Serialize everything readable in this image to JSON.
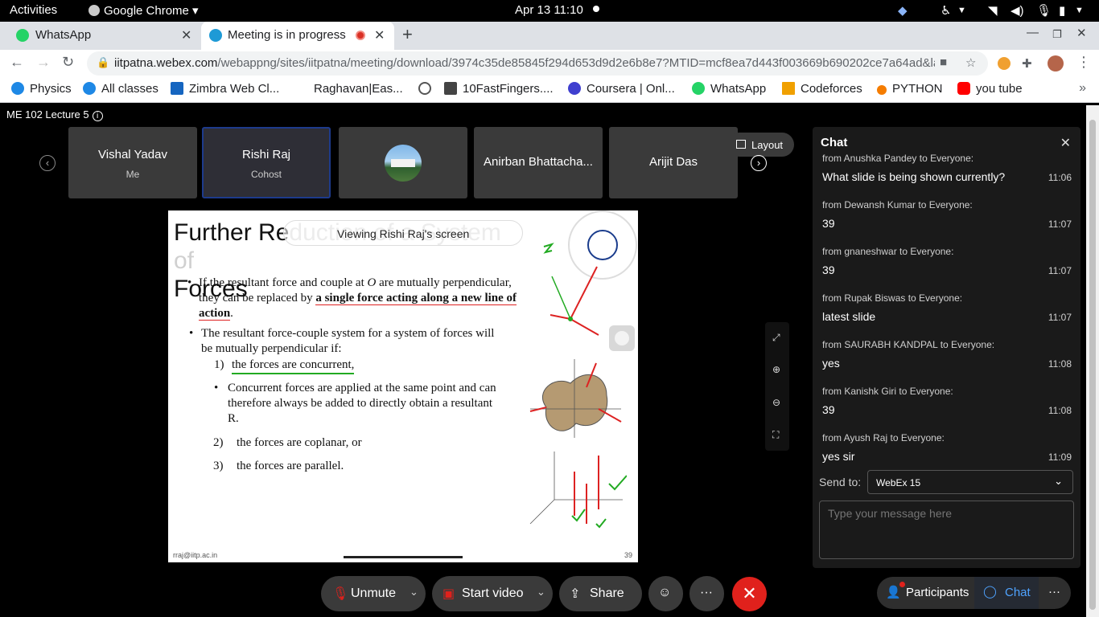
{
  "system": {
    "activities": "Activities",
    "app": "Google Chrome",
    "datetime": "Apr 13  11:10"
  },
  "tabs": [
    {
      "title": "WhatsApp"
    },
    {
      "title": "Meeting is in progress"
    }
  ],
  "toolbar": {
    "url_host": "iitpatna.webex.com",
    "url_path": "/webappng/sites/iitpatna/meeting/download/3974c35de85845f294d653d9d2e6b8e7?MTID=mcf8ea7d443f003669b690202ce7a64ad&la..."
  },
  "bookmarks": [
    {
      "label": "Physics",
      "color": "#1e88e5"
    },
    {
      "label": "All classes",
      "color": "#1e88e5"
    },
    {
      "label": "Zimbra Web Cl...",
      "color": "#1565c0"
    },
    {
      "label": "Raghavan|Eas...",
      "color": ""
    },
    {
      "label": "10FastFingers....",
      "color": "#444444"
    },
    {
      "label": "Coursera | Onl...",
      "color": "#3f3fcf"
    },
    {
      "label": "WhatsApp",
      "color": "#25d366"
    },
    {
      "label": "Codeforces",
      "color": "#f0a000"
    },
    {
      "label": "PYTHON",
      "color": "#f57c00"
    },
    {
      "label": "you tube",
      "color": "#ff0000"
    }
  ],
  "meeting": {
    "title": "ME 102 Lecture 5",
    "participants": [
      {
        "name": "Vishal Yadav",
        "role": "Me"
      },
      {
        "name": "Rishi Raj",
        "role": "Cohost"
      },
      {
        "name": "",
        "role": ""
      },
      {
        "name": "Anirban Bhattacha...",
        "role": ""
      },
      {
        "name": "Arijit Das",
        "role": ""
      }
    ],
    "layout_label": "Layout",
    "viewing_label": "Viewing Rishi Raj's screen"
  },
  "slide": {
    "title_part1": "Further Re",
    "title_faded": "duction of a System of",
    "title_line2": "Forces",
    "bullet1_a": "If the resultant force and couple at ",
    "bullet1_o": "O",
    "bullet1_b": " are mutually perpendicular, they can be replaced by ",
    "bullet1_bold": "a single force acting along a new line of action",
    "bullet1_c": ".",
    "bullet2": "The resultant force-couple system for a system of forces will be mutually perpendicular if:",
    "item1_num": "1)",
    "item1": "the forces are concurrent,",
    "sub_bullet": "Concurrent forces are applied at the same point and can therefore always be added to directly obtain a resultant R.",
    "item2_num": "2)",
    "item2": "the forces are coplanar, or",
    "item3_num": "3)",
    "item3": "the forces are parallel.",
    "footer_left": "rraj@iitp.ac.in",
    "page_number": "39"
  },
  "chat": {
    "title": "Chat",
    "messages": [
      {
        "from": "from Anushka Pandey to Everyone:",
        "text": "What slide is being shown currently?",
        "time": "11:06"
      },
      {
        "from": "from Dewansh Kumar to Everyone:",
        "text": "39",
        "time": "11:07"
      },
      {
        "from": "from gnaneshwar to Everyone:",
        "text": "39",
        "time": "11:07"
      },
      {
        "from": "from Rupak Biswas to Everyone:",
        "text": "latest slide",
        "time": "11:07"
      },
      {
        "from": "from SAURABH KANDPAL to Everyone:",
        "text": "yes",
        "time": "11:08"
      },
      {
        "from": "from Kanishk Giri to Everyone:",
        "text": "39",
        "time": "11:08"
      },
      {
        "from": "from Ayush Raj to Everyone:",
        "text": "yes sir",
        "time": "11:09"
      }
    ],
    "send_to_label": "Send to:",
    "send_to_value": "WebEx 15",
    "input_placeholder": "Type your message here"
  },
  "controls": {
    "unmute": "Unmute",
    "start_video": "Start video",
    "share": "Share",
    "participants": "Participants",
    "chat": "Chat"
  }
}
